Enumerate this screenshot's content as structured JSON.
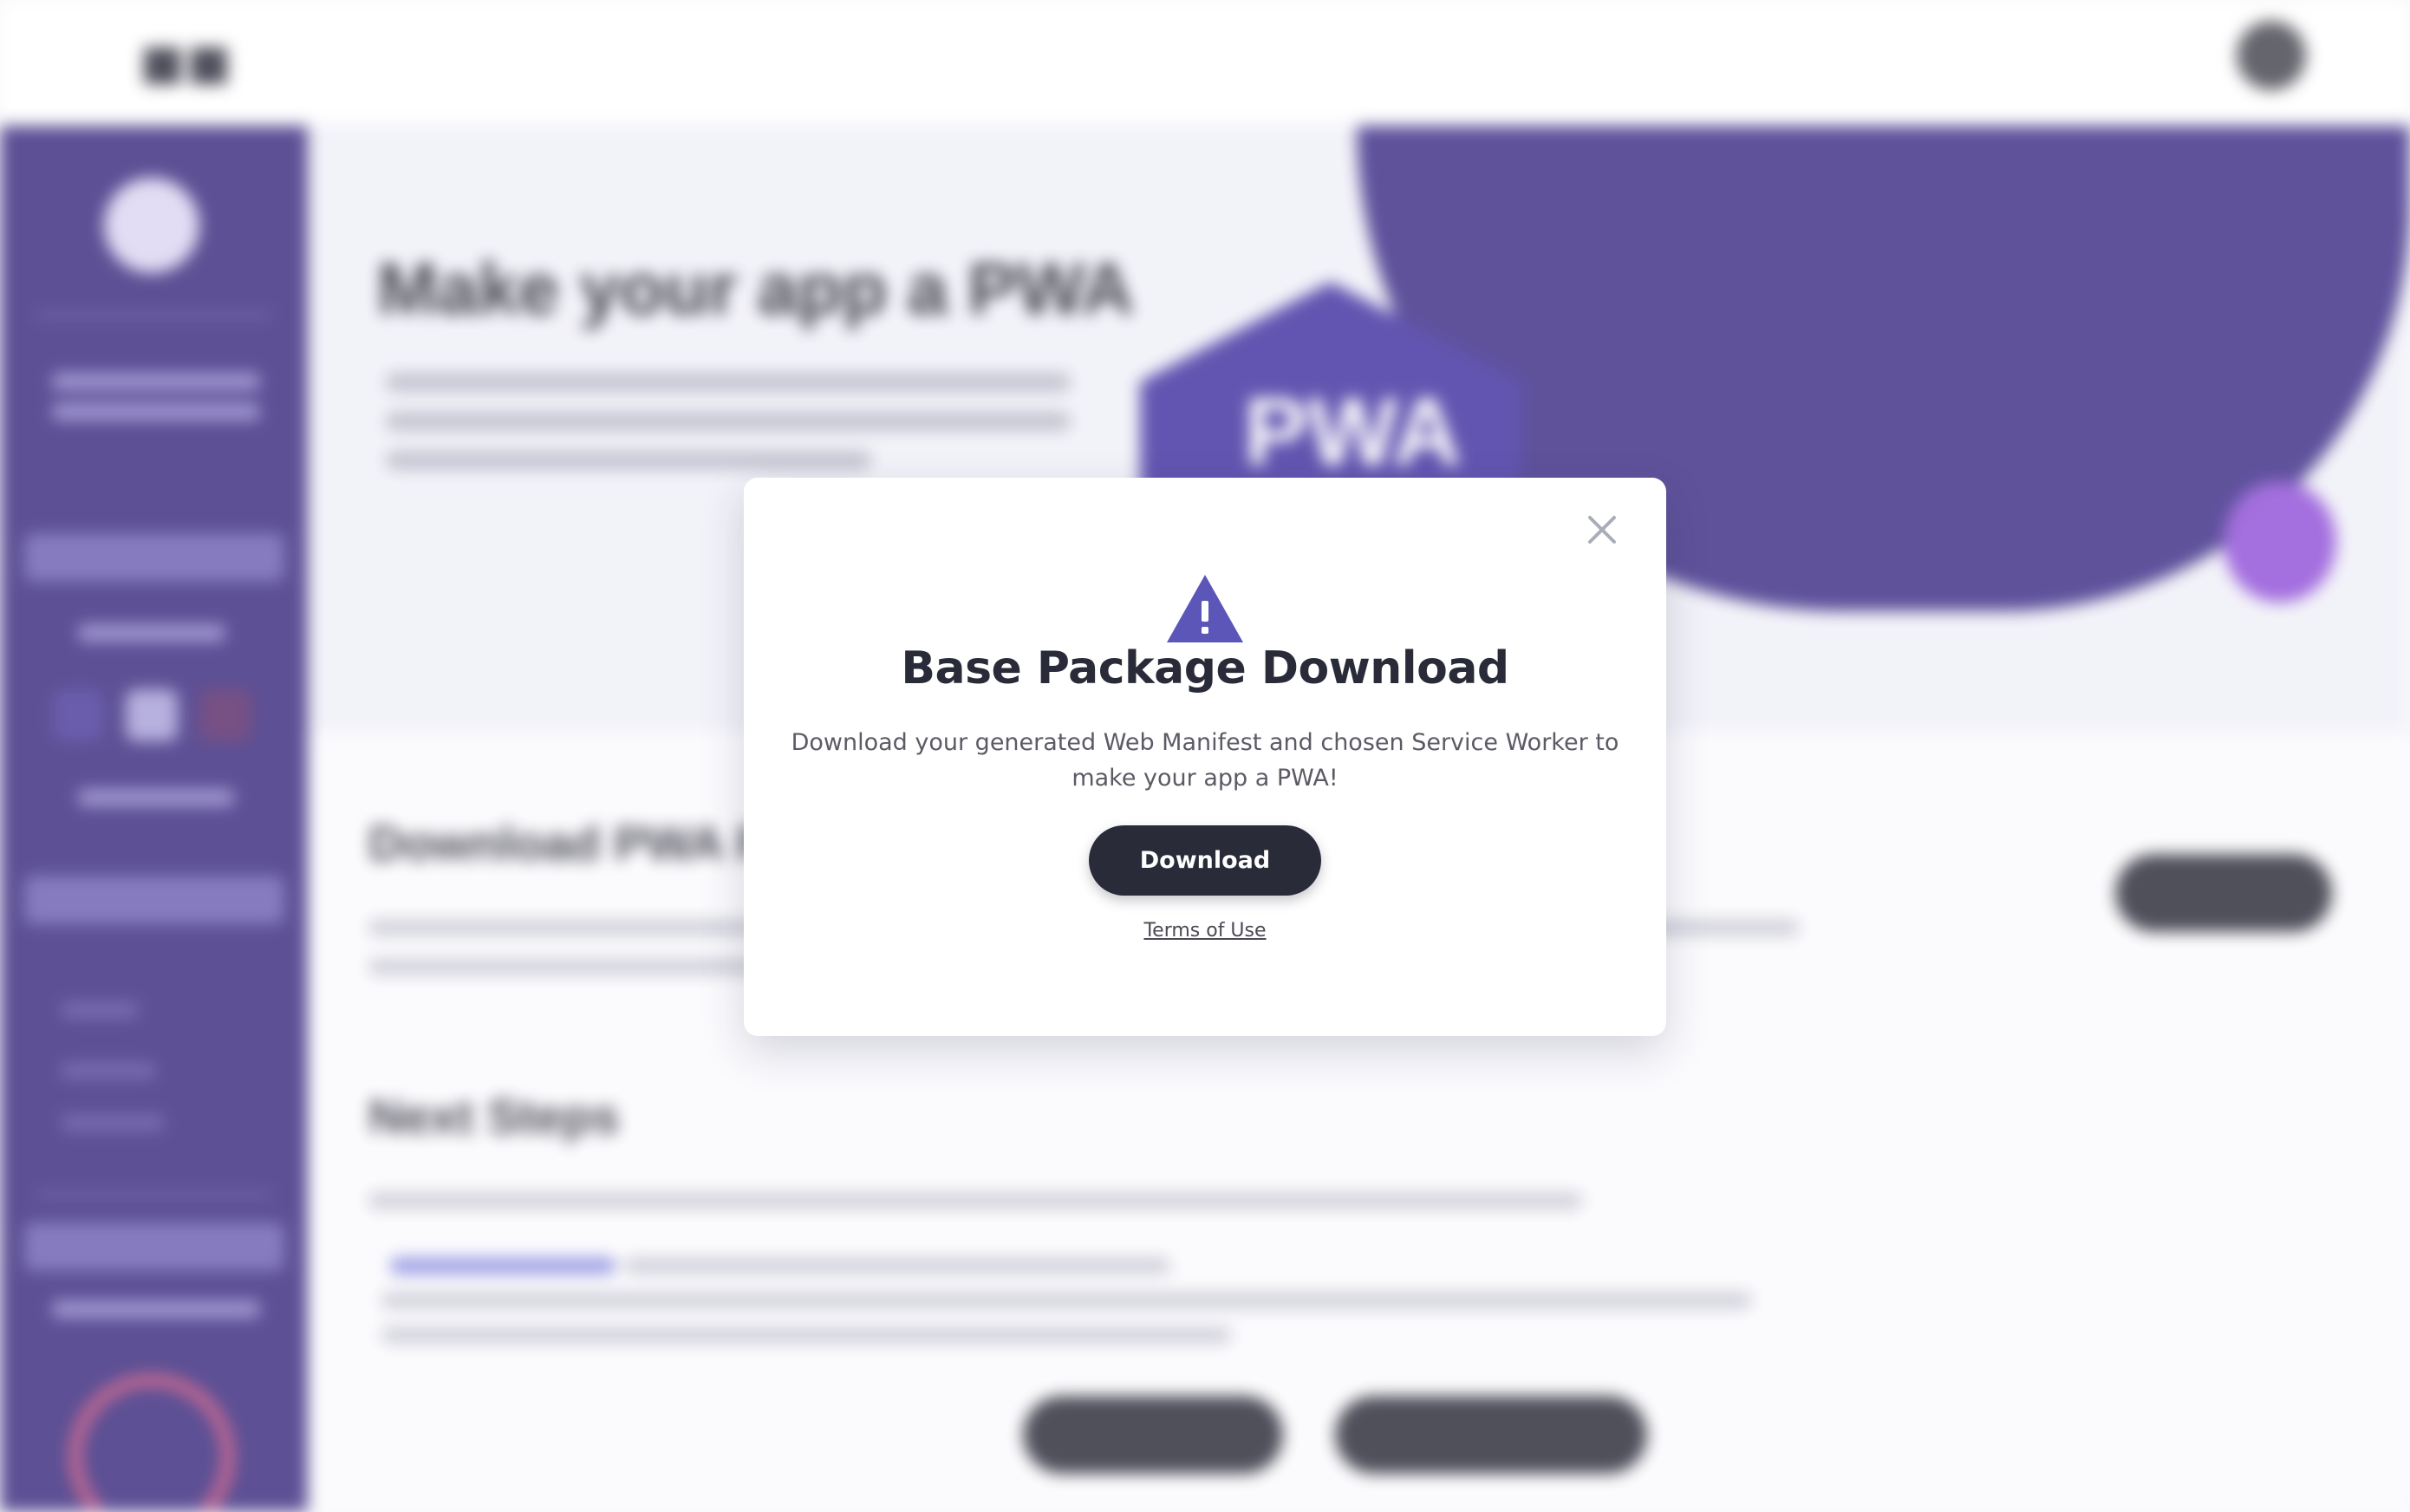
{
  "background": {
    "hero_title": "Make your app a PWA",
    "pwa_badge": "PWA",
    "download_section_title": "Download PWA Package",
    "next_steps_title": "Next Steps"
  },
  "modal": {
    "title": "Base Package Download",
    "description": "Download your generated Web Manifest and chosen Service Worker to make your app a PWA!",
    "download_button": "Download",
    "terms_link": "Terms of Use",
    "close_icon": "close-icon",
    "warning_icon": "warning-icon",
    "accent_color": "#5b56b8",
    "button_color": "#292b39"
  }
}
